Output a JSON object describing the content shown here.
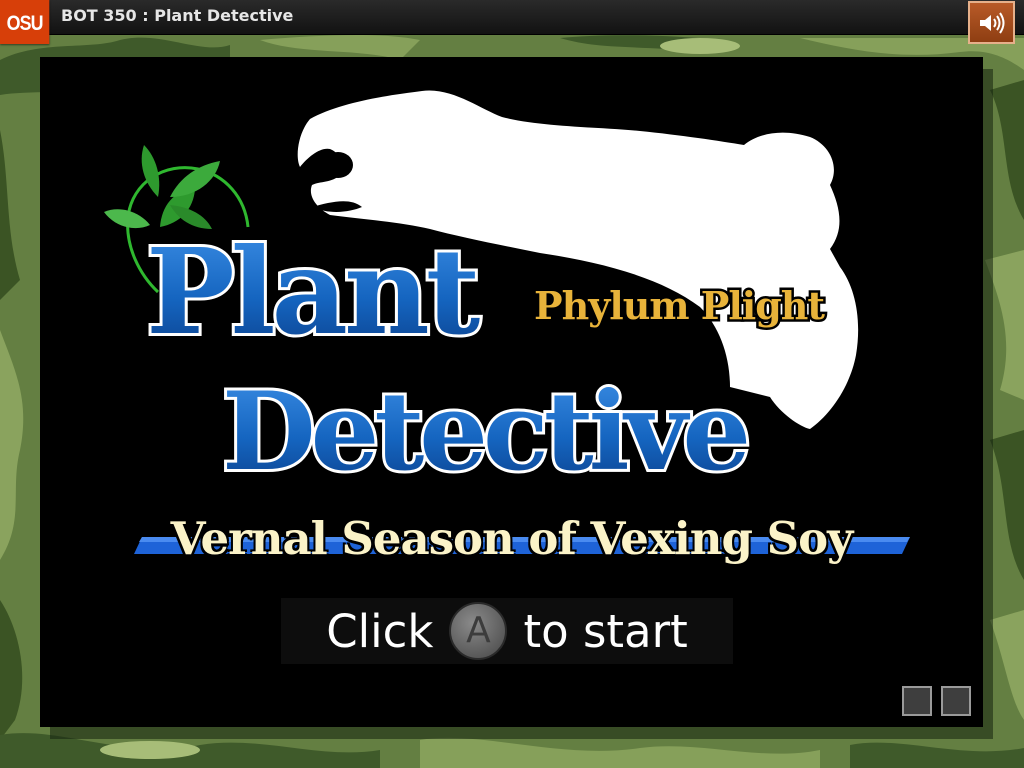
{
  "header": {
    "logo_text": "OSU",
    "course_title": "BOT 350 : Plant Detective",
    "sound_icon": "speaker-volume-icon"
  },
  "title_screen": {
    "title_line1": "Plant",
    "title_line2": "Detective",
    "tagline": "Phylum Plight",
    "subtitle": "Vernal Season of Vexing Soy",
    "prompt_before": "Click",
    "prompt_button": "A",
    "prompt_after": "to start"
  },
  "colors": {
    "osu_orange": "#d73f09",
    "title_blue": "#1565c0",
    "tagline_gold": "#e8b33a",
    "subtitle_cream": "#fbf3c8",
    "stripe_blue": "#1e63d8",
    "leaf_green": "#2e9a2e"
  }
}
